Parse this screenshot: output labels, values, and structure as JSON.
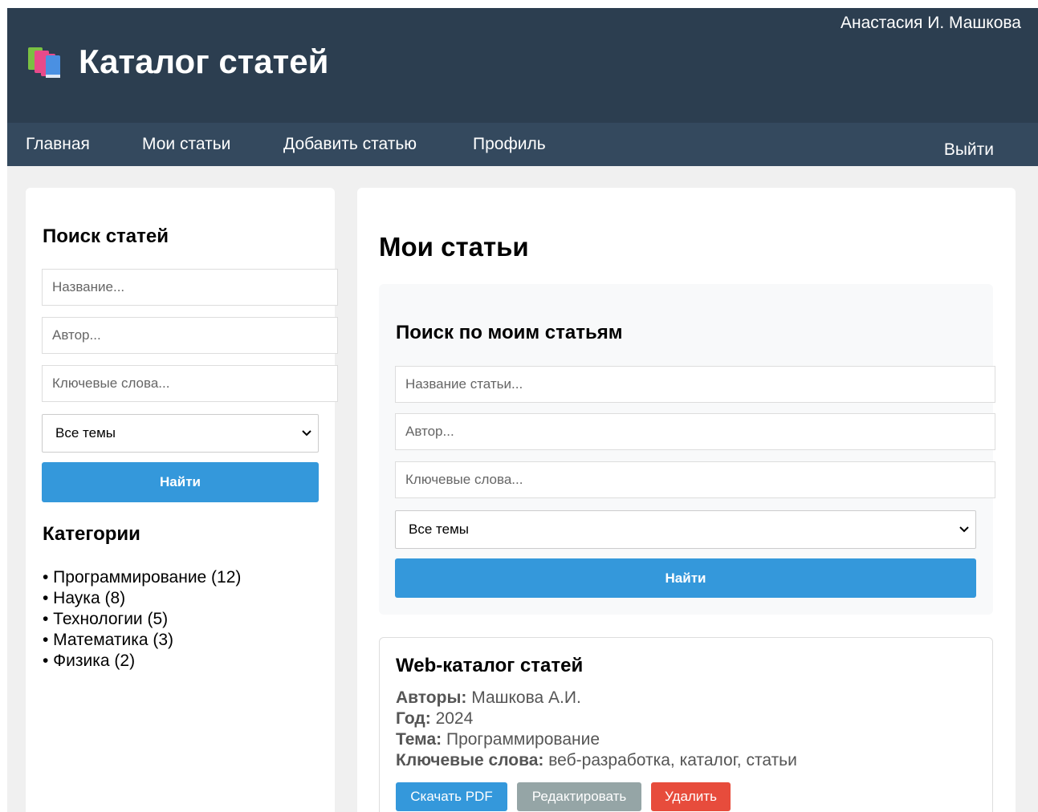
{
  "header": {
    "site_title": "Каталог статей",
    "user_name": "Анастасия И. Машкова",
    "logo_icon": "books-icon"
  },
  "nav": {
    "items": [
      "Главная",
      "Мои статьи",
      "Добавить статью",
      "Профиль"
    ],
    "logout": "Выйти"
  },
  "sidebar": {
    "search_title": "Поиск статей",
    "title_placeholder": "Название...",
    "author_placeholder": "Автор...",
    "keywords_placeholder": "Ключевые слова...",
    "topic_select": "Все темы",
    "search_button": "Найти",
    "categories_title": "Категории",
    "categories": [
      "• Программирование (12)",
      "• Наука (8)",
      "• Технологии (5)",
      "• Математика (3)",
      "• Физика (2)"
    ]
  },
  "main": {
    "page_title": "Мои статьи",
    "search": {
      "title": "Поиск по моим статьям",
      "title_placeholder": "Название статьи...",
      "author_placeholder": "Автор...",
      "keywords_placeholder": "Ключевые слова...",
      "topic_select": "Все темы",
      "search_button": "Найти"
    },
    "articles": [
      {
        "title": "Web-каталог статей",
        "authors_label": "Авторы:",
        "authors": "Машкова А.И.",
        "year_label": "Год:",
        "year": "2024",
        "topic_label": "Тема:",
        "topic": "Программирование",
        "keywords_label": "Ключевые слова:",
        "keywords": "веб-разработка, каталог, статьи",
        "download_button": "Скачать PDF",
        "edit_button": "Редактировать",
        "delete_button": "Удалить"
      }
    ]
  },
  "colors": {
    "header_bg": "#2c3e50",
    "nav_bg": "#34495e",
    "primary": "#3498db",
    "secondary": "#95a5a6",
    "danger": "#e74c3c"
  }
}
